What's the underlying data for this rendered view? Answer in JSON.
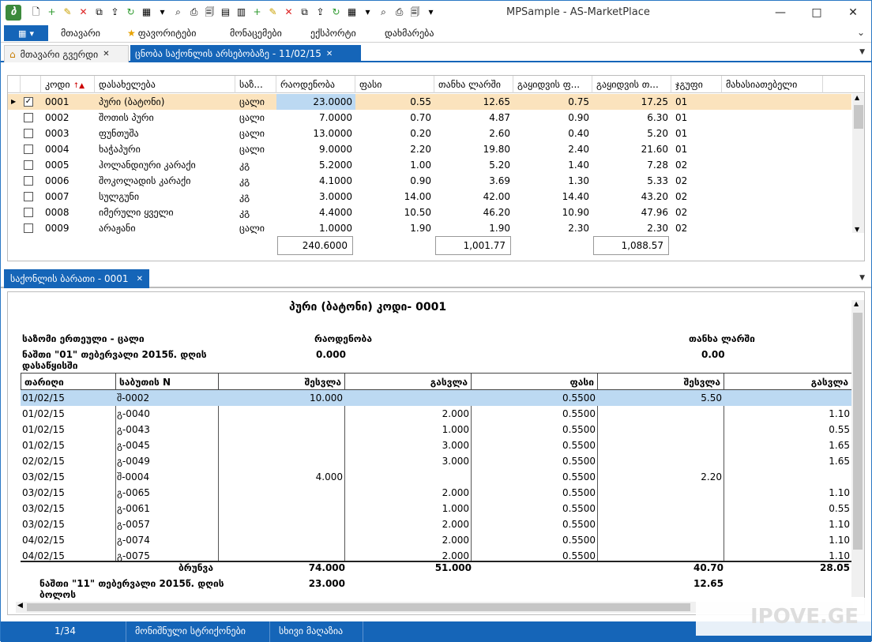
{
  "window": {
    "title": "MPSample - AS-MarketPlace",
    "app_icon": "ბ"
  },
  "toolbar_icons": [
    "new-document-icon",
    "add-icon",
    "edit-icon",
    "delete-icon",
    "copy-icon",
    "export-icon",
    "refresh-icon",
    "grid-icon",
    "chevron-down-icon",
    "find-icon",
    "print-icon",
    "preview-icon",
    "form-icon",
    "form2-icon",
    "add-icon",
    "edit-icon",
    "delete-icon",
    "copy-icon",
    "export-icon",
    "refresh-icon",
    "grid-icon",
    "chevron-down-icon",
    "find-icon",
    "print-icon",
    "preview-icon",
    "chevron-down-icon"
  ],
  "menu": {
    "items": [
      "მთავარი",
      "ფავორიტები",
      "მონაცემები",
      "ექსპორტი",
      "დახმარება"
    ]
  },
  "tabs": [
    {
      "label": "მთავარი გვერდი",
      "active": false
    },
    {
      "label": "ცნობა საქონლის არსებობაზე - 11/02/15",
      "active": true
    }
  ],
  "grid": {
    "columns": [
      "კოდი",
      "დასახელება",
      "საზ...",
      "რაოდენობა",
      "ფასი",
      "თანხა ლარში",
      "გაყიდვის ფ...",
      "გაყიდვის თ...",
      "ჯგუფი",
      "მახასიათებელი"
    ],
    "rows": [
      {
        "selected": true,
        "checked": true,
        "code": "0001",
        "name": "პური (ბატონი)",
        "unit": "ცალი",
        "qty": "23.0000",
        "price": "0.55",
        "sum": "12.65",
        "sprice": "0.75",
        "ssum": "17.25",
        "group": "01"
      },
      {
        "selected": false,
        "checked": false,
        "code": "0002",
        "name": "შოთის პური",
        "unit": "ცალი",
        "qty": "7.0000",
        "price": "0.70",
        "sum": "4.87",
        "sprice": "0.90",
        "ssum": "6.30",
        "group": "01"
      },
      {
        "selected": false,
        "checked": false,
        "code": "0003",
        "name": "ფუნთუშა",
        "unit": "ცალი",
        "qty": "13.0000",
        "price": "0.20",
        "sum": "2.60",
        "sprice": "0.40",
        "ssum": "5.20",
        "group": "01"
      },
      {
        "selected": false,
        "checked": false,
        "code": "0004",
        "name": "ხაჭაპური",
        "unit": "ცალი",
        "qty": "9.0000",
        "price": "2.20",
        "sum": "19.80",
        "sprice": "2.40",
        "ssum": "21.60",
        "group": "01"
      },
      {
        "selected": false,
        "checked": false,
        "code": "0005",
        "name": "ჰოლანდიური კარაქი",
        "unit": "კგ",
        "qty": "5.2000",
        "price": "1.00",
        "sum": "5.20",
        "sprice": "1.40",
        "ssum": "7.28",
        "group": "02"
      },
      {
        "selected": false,
        "checked": false,
        "code": "0006",
        "name": "შოკოლადის კარაქი",
        "unit": "კგ",
        "qty": "4.1000",
        "price": "0.90",
        "sum": "3.69",
        "sprice": "1.30",
        "ssum": "5.33",
        "group": "02"
      },
      {
        "selected": false,
        "checked": false,
        "code": "0007",
        "name": "სულგუნი",
        "unit": "კგ",
        "qty": "3.0000",
        "price": "14.00",
        "sum": "42.00",
        "sprice": "14.40",
        "ssum": "43.20",
        "group": "02"
      },
      {
        "selected": false,
        "checked": false,
        "code": "0008",
        "name": "იმერული ყველი",
        "unit": "კგ",
        "qty": "4.4000",
        "price": "10.50",
        "sum": "46.20",
        "sprice": "10.90",
        "ssum": "47.96",
        "group": "02"
      },
      {
        "selected": false,
        "checked": false,
        "code": "0009",
        "name": "არაჟანი",
        "unit": "ცალი",
        "qty": "1.0000",
        "price": "1.90",
        "sum": "1.90",
        "sprice": "2.30",
        "ssum": "2.30",
        "group": "02"
      }
    ],
    "totals": {
      "qty": "240.6000",
      "sum": "1,001.77",
      "ssum": "1,088.57"
    }
  },
  "card_tab": {
    "label": "საქონლის ბარათი - 0001"
  },
  "report": {
    "title": "პური (ბატონი) კოდი- 0001",
    "unit_label": "საზომი ერთეული - ცალი",
    "qty_label": "რაოდენობა",
    "sum_label": "თანხა ლარში",
    "opening_label": "ნაშთი \"01\" თებერვალი 2015წ. დღის დასაწყისში",
    "opening_qty": "0.000",
    "opening_sum": "0.00",
    "columns": [
      "თარიღი",
      "საბუთის N",
      "შესვლა",
      "გასვლა",
      "ფასი",
      "შესვლა",
      "გასვლა"
    ],
    "rows": [
      {
        "date": "01/02/15",
        "doc": "შ-0002",
        "in": "10.000",
        "out": "",
        "price": "0.5500",
        "sin": "5.50",
        "sout": "",
        "selected": true
      },
      {
        "date": "01/02/15",
        "doc": "გ-0040",
        "in": "",
        "out": "2.000",
        "price": "0.5500",
        "sin": "",
        "sout": "1.10",
        "selected": false
      },
      {
        "date": "01/02/15",
        "doc": "გ-0043",
        "in": "",
        "out": "1.000",
        "price": "0.5500",
        "sin": "",
        "sout": "0.55",
        "selected": false
      },
      {
        "date": "01/02/15",
        "doc": "გ-0045",
        "in": "",
        "out": "3.000",
        "price": "0.5500",
        "sin": "",
        "sout": "1.65",
        "selected": false
      },
      {
        "date": "02/02/15",
        "doc": "გ-0049",
        "in": "",
        "out": "3.000",
        "price": "0.5500",
        "sin": "",
        "sout": "1.65",
        "selected": false
      },
      {
        "date": "03/02/15",
        "doc": "შ-0004",
        "in": "4.000",
        "out": "",
        "price": "0.5500",
        "sin": "2.20",
        "sout": "",
        "selected": false
      },
      {
        "date": "03/02/15",
        "doc": "გ-0065",
        "in": "",
        "out": "2.000",
        "price": "0.5500",
        "sin": "",
        "sout": "1.10",
        "selected": false
      },
      {
        "date": "03/02/15",
        "doc": "გ-0061",
        "in": "",
        "out": "1.000",
        "price": "0.5500",
        "sin": "",
        "sout": "0.55",
        "selected": false
      },
      {
        "date": "03/02/15",
        "doc": "გ-0057",
        "in": "",
        "out": "2.000",
        "price": "0.5500",
        "sin": "",
        "sout": "1.10",
        "selected": false
      },
      {
        "date": "04/02/15",
        "doc": "გ-0074",
        "in": "",
        "out": "2.000",
        "price": "0.5500",
        "sin": "",
        "sout": "1.10",
        "selected": false
      },
      {
        "date": "04/02/15",
        "doc": "გ-0075",
        "in": "",
        "out": "2.000",
        "price": "0.5500",
        "sin": "",
        "sout": "1.10",
        "selected": false
      }
    ],
    "turnover_label": "ბრუნვა",
    "turnover_in": "74.000",
    "turnover_out": "51.000",
    "turnover_sin": "40.70",
    "turnover_sout": "28.05",
    "closing_label": "ნაშთი \"11\" თებერვალი 2015წ. დღის ბოლოს",
    "closing_qty": "23.000",
    "closing_sum": "12.65"
  },
  "status": {
    "record": "1/34",
    "marked": "მონიშნული სტრიქონები",
    "filter": "სხივი მაღაზია"
  },
  "watermark": "IPOVE.GE"
}
